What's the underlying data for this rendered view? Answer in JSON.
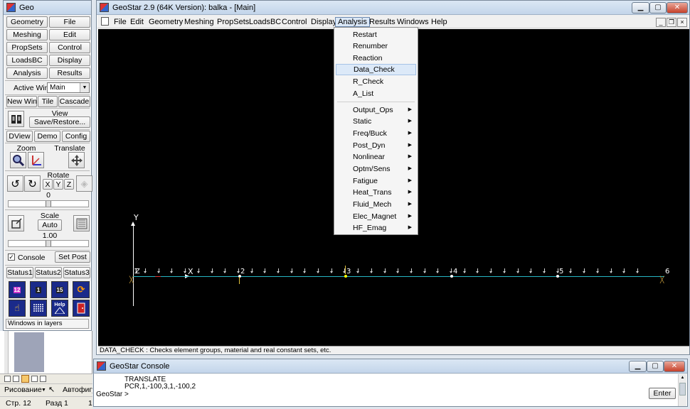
{
  "palette": {
    "title": "Geo",
    "row_buttons": [
      [
        "Geometry",
        "File"
      ],
      [
        "Meshing",
        "Edit"
      ],
      [
        "PropSets",
        "Control"
      ],
      [
        "LoadsBC",
        "Display"
      ],
      [
        "Analysis",
        "Results"
      ]
    ],
    "active_win_label": "Active Win",
    "active_win_value": "Main",
    "new_win": "New Win",
    "tile": "Tile",
    "cascade": "Cascade",
    "view_label": "View",
    "save_restore": "Save/Restore...",
    "dview": "DView",
    "demo": "Demo",
    "config": "Config",
    "zoom_label": "Zoom",
    "translate_label": "Translate",
    "rotate_label": "Rotate",
    "rotate_axes": [
      "X",
      "Y",
      "Z"
    ],
    "rotate_value": "0",
    "scale_label": "Scale",
    "scale_auto": "Auto",
    "scale_value": "1.00",
    "console_label": "Console",
    "console_checked": true,
    "set_post": "Set Post",
    "status_buttons": [
      "Status1",
      "Status2",
      "Status3"
    ],
    "tool_icons": [
      "12",
      "1",
      "15",
      "",
      "",
      "",
      "Help",
      ""
    ],
    "footer": "Windows in layers"
  },
  "main": {
    "title": "GeoStar 2.9 (64K Version): balka - [Main]",
    "menu": [
      "File",
      "Edit",
      "Geometry",
      "Meshing",
      "PropSets",
      "LoadsBC",
      "Control",
      "Display",
      "Analysis",
      "Results",
      "Windows",
      "Help"
    ],
    "active_menu": "Analysis",
    "status_text": "DATA_CHECK : Checks element groups, material and real constant sets, etc."
  },
  "analysis_menu": {
    "items_top": [
      "Restart",
      "Renumber",
      "Reaction",
      "Data_Check",
      "R_Check",
      "A_List"
    ],
    "highlighted": "Data_Check",
    "items_sub": [
      "Output_Ops",
      "Static",
      "Freq/Buck",
      "Post_Dyn",
      "Nonlinear",
      "Optm/Sens",
      "Fatigue",
      "Heat_Trans",
      "Fluid_Mech",
      "Elec_Magnet",
      "HF_Emag"
    ]
  },
  "model": {
    "axis_y": "Y",
    "axis_x": "X",
    "axis_origin": "Z",
    "node_labels": [
      "1",
      "2",
      "3",
      "4",
      "5",
      "6"
    ],
    "beam_color": "#26b5c4"
  },
  "console": {
    "title": "GeoStar Console",
    "lines": [
      "TRANSLATE",
      "PCR,1,-100,3,1,-100,2"
    ],
    "prompt": "GeoStar >",
    "enter": "Enter"
  },
  "word_bar": {
    "drawing": "Рисование",
    "autoshapes": "Автофигу",
    "page": "Стр. 12",
    "section": "Разд 1",
    "extra": "1"
  }
}
